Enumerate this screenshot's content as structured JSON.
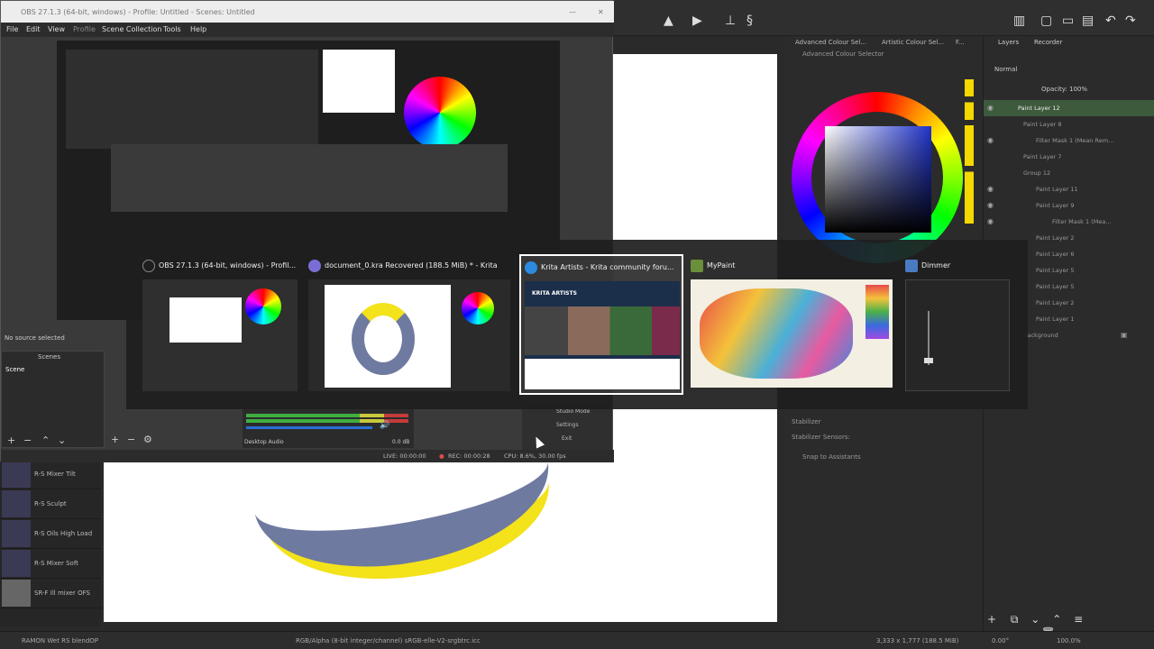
{
  "krita": {
    "dock_tabs": [
      "Advanced Colour Sel...",
      "Artistic Colour Sel...",
      "F..."
    ],
    "dock_title": "Advanced Colour Selector",
    "layers_tabs": [
      "Layers",
      "Recorder"
    ],
    "blend_mode": "Normal",
    "opacity": "Opacity: 100%",
    "layers": [
      {
        "name": "Paint Layer 12",
        "active": true
      },
      {
        "name": "Paint Layer 8"
      },
      {
        "name": "Filter Mask 1 (Mean Rem..."
      },
      {
        "name": "Paint Layer 7"
      },
      {
        "name": "Group 12"
      },
      {
        "name": "Paint Layer 11"
      },
      {
        "name": "Paint Layer 9"
      },
      {
        "name": "Filter Mask 1 (Mea..."
      },
      {
        "name": "Paint Layer 2"
      },
      {
        "name": "Paint Layer 6"
      },
      {
        "name": "Paint Layer 5"
      },
      {
        "name": "Paint Layer 5"
      },
      {
        "name": "Paint Layer 2"
      },
      {
        "name": "Paint Layer 1"
      },
      {
        "name": "Background"
      }
    ],
    "tool_options": [
      "Stabilizer Sensors:",
      "Snap to Assistants"
    ],
    "tool_option_hidden": "Stabilizer",
    "brushes": [
      "R-S Mixer Tilt",
      "R-S Sculpt",
      "R-S Oils High Load",
      "R-S Mixer Soft",
      "SR-F Ill mixer OFS"
    ],
    "status": {
      "brush": "RAMON Wet RS blendOP",
      "color_profile": "RGB/Alpha (8-bit integer/channel)  sRGB-elle-V2-srgbtrc.icc",
      "size": "3,333 x 1,777 (188.5 MiB)",
      "zoom": "100.0%",
      "rotation": "0.00°"
    },
    "colors": {
      "accent_yellow": "#f4e21a",
      "stroke_blue": "#6f7aa0",
      "active_layer": "#3d5a3d"
    }
  },
  "obs": {
    "title": "OBS 27.1.3 (64-bit, windows) - Profile: Untitled - Scenes: Untitled",
    "menu": [
      "File",
      "Edit",
      "View",
      "Profile",
      "Scene Collection",
      "Tools",
      "Help"
    ],
    "no_source": "No source selected",
    "scenes_label": "Scenes",
    "scene_item": "Scene",
    "mixer_label": "Desktop Audio",
    "mixer_db": "0.0 dB",
    "controls": [
      "Studio Mode",
      "Settings",
      "Exit"
    ],
    "status": {
      "live": "LIVE: 00:00:00",
      "rec": "REC: 00:00:28",
      "cpu": "CPU: 8.6%, 30.00 fps"
    }
  },
  "switcher": {
    "windows": [
      {
        "title": "OBS 27.1.3 (64-bit, windows) - Profil...",
        "icon_color": "#1e1e1e"
      },
      {
        "title": "document_0.kra Recovered (188.5 MiB) * - Krita",
        "icon_color": "#7a6ed6"
      },
      {
        "title": "Krita Artists - Krita community foru...",
        "icon_color": "#2c8be0",
        "selected": true
      },
      {
        "title": "MyPaint",
        "icon_color": "#6b8f3a"
      },
      {
        "title": "Dimmer",
        "icon_color": "#4a7ac2"
      }
    ],
    "krita_artists_heading": "KRITA ARTISTS"
  }
}
